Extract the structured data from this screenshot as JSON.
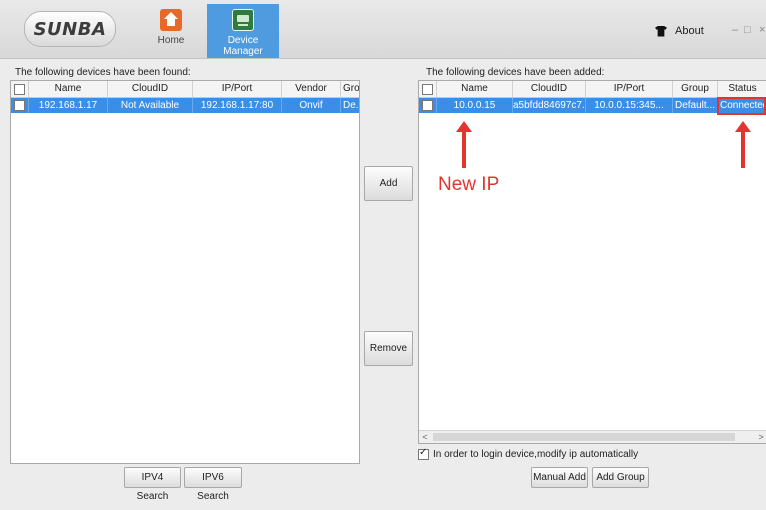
{
  "header": {
    "logo": "SUNBA",
    "nav": [
      {
        "label": "Home"
      },
      {
        "label": "Device Manager"
      }
    ],
    "about": "About",
    "window_controls": {
      "minimize": "–",
      "maximize": "□",
      "close": "×"
    }
  },
  "found": {
    "label": "The following devices have been found:",
    "columns": [
      "Name",
      "CloudID",
      "IP/Port",
      "Vendor",
      "Group"
    ],
    "rows": [
      {
        "name": "192.168.1.17",
        "cloudid": "Not Available",
        "ipport": "192.168.1.17:80",
        "vendor": "Onvif",
        "group": "De..."
      }
    ]
  },
  "added": {
    "label": "The following devices have been added:",
    "columns": [
      "Name",
      "CloudID",
      "IP/Port",
      "Group",
      "Status"
    ],
    "rows": [
      {
        "name": "10.0.0.15",
        "cloudid": "a5bfdd84697c7...",
        "ipport": "10.0.0.15:345...",
        "group": "Default...",
        "status": "Connected"
      }
    ]
  },
  "buttons": {
    "add": "Add",
    "remove": "Remove",
    "ipv4": "IPV4 Search",
    "ipv6": "IPV6 Search",
    "manual_add": "Manual Add",
    "add_group": "Add Group"
  },
  "auto_modify": {
    "label": "In order to login device,modify ip automatically",
    "checked": true
  },
  "annotation": {
    "new_ip": "New IP",
    "color": "#e3342f"
  },
  "colors": {
    "selection": "#3a8ee6",
    "nav_active": "#4e9be0"
  },
  "icons": [
    "home-icon",
    "device-manager-icon",
    "shirt-icon",
    "checkbox-icon",
    "arrow-left-icon",
    "arrow-right-icon"
  ]
}
